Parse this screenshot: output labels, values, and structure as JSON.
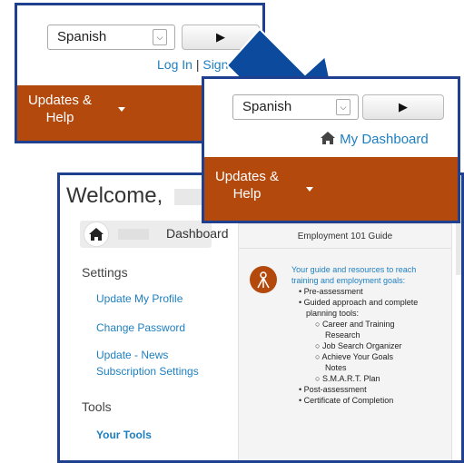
{
  "back_panel": {
    "language": "Spanish",
    "play_symbol": "▶",
    "login": "Log In",
    "separator": "|",
    "signup": "Sign Up",
    "menu_label_line1": "Updates &",
    "menu_label_line2": "Help"
  },
  "front_panel": {
    "language": "Spanish",
    "play_symbol": "▶",
    "dashboard_link": "My Dashboard",
    "menu_label_line1": "Updates &",
    "menu_label_line2": "Help"
  },
  "page": {
    "welcome": "Welcome,",
    "dashboard_label": "Dashboard",
    "settings_heading": "Settings",
    "settings_links": [
      "Update My Profile",
      "Change Password",
      "Update - News",
      "Subscription Settings"
    ],
    "tools_heading": "Tools",
    "tools_link": "Your Tools",
    "guide_title": "Employment 101 Guide",
    "guide_intro_line1": "Your guide and resources to reach",
    "guide_intro_line2": "training and employment goals:",
    "bullets": [
      "Pre-assessment",
      "Guided approach and complete",
      "planning tools:",
      "Post-assessment",
      "Certificate of Completion"
    ],
    "sub_bullets": [
      "Career and Training",
      "Research",
      "Job Search Organizer",
      "Achieve Your Goals",
      "Notes",
      "S.M.A.R.T. Plan"
    ]
  },
  "colors": {
    "frame_blue": "#1f3f8f",
    "orange": "#b4490d",
    "link_blue": "#1e7fc0",
    "arrow_blue": "#0b4a9c"
  },
  "icons": [
    "home-icon",
    "career-path-icon",
    "chevron-down-icon",
    "play-icon",
    "menu-caret-icon",
    "pointer-arrow"
  ]
}
